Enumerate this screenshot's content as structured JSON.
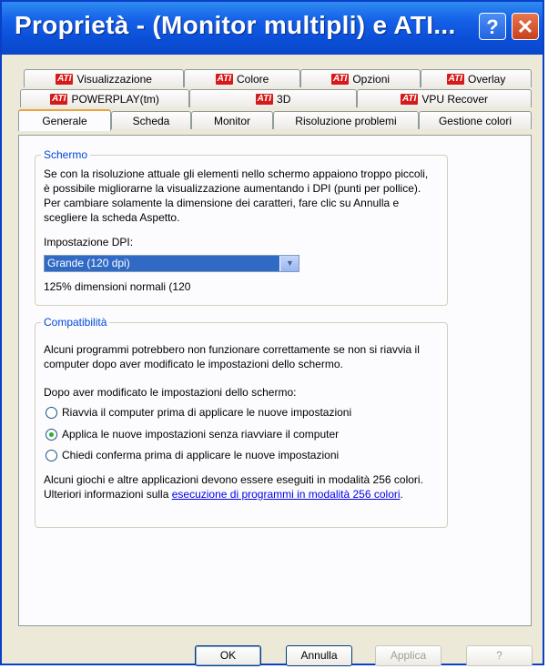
{
  "window": {
    "title": "Proprietà - (Monitor multipli) e ATI...",
    "help_label": "?",
    "close_label": "✕"
  },
  "tabs_row1": [
    {
      "label": "Visualizzazione",
      "brand": "ATI"
    },
    {
      "label": "Colore",
      "brand": "ATI"
    },
    {
      "label": "Opzioni",
      "brand": "ATI"
    },
    {
      "label": "Overlay",
      "brand": "ATI"
    }
  ],
  "tabs_row2": [
    {
      "label": "POWERPLAY(tm)",
      "brand": "ATI"
    },
    {
      "label": "3D",
      "brand": "ATI"
    },
    {
      "label": "VPU Recover",
      "brand": "ATI"
    }
  ],
  "tabs_row3": [
    {
      "label": "Generale"
    },
    {
      "label": "Scheda"
    },
    {
      "label": "Monitor"
    },
    {
      "label": "Risoluzione problemi"
    },
    {
      "label": "Gestione colori"
    }
  ],
  "schermo": {
    "legend": "Schermo",
    "description": "Se con la risoluzione attuale gli elementi nello schermo appaiono troppo piccoli, è possibile migliorarne la visualizzazione aumentando i DPI (punti per pollice). Per cambiare solamente la dimensione dei caratteri, fare clic su Annulla e scegliere la scheda Aspetto.",
    "dpi_label": "Impostazione DPI:",
    "dpi_value": "Grande (120 dpi)",
    "dpi_note": "125% dimensioni normali (120"
  },
  "compat": {
    "legend": "Compatibilità",
    "description": "Alcuni programmi potrebbero non funzionare correttamente se non si riavvia il computer dopo aver modificato le impostazioni dello schermo.",
    "after_label": "Dopo aver modificato le impostazioni dello schermo:",
    "options": [
      {
        "label": "Riavvia il computer prima di applicare le nuove impostazioni",
        "selected": false
      },
      {
        "label": "Applica le nuove impostazioni senza riavviare il computer",
        "selected": true
      },
      {
        "label": "Chiedi conferma prima di applicare le nuove impostazioni",
        "selected": false
      }
    ],
    "footer_text": "Alcuni giochi e altre applicazioni devono essere eseguiti in modalità 256 colori. Ulteriori informazioni sulla",
    "footer_link": "esecuzione di programmi in modalità 256 colori",
    "footer_end": "."
  },
  "buttons": {
    "ok": "OK",
    "cancel": "Annulla",
    "apply": "Applica",
    "help": "?"
  }
}
